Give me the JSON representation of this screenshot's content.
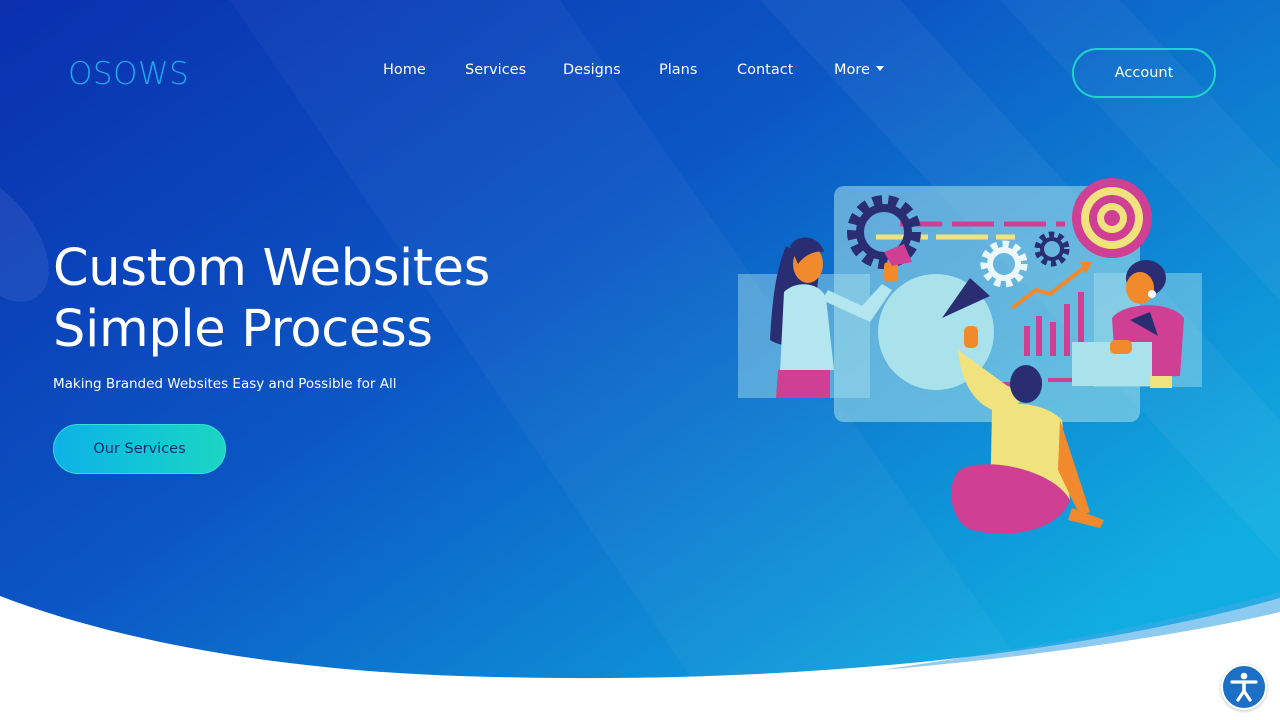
{
  "brand": {
    "logo_text": "OSOWS"
  },
  "nav": {
    "items": [
      {
        "label": "Home"
      },
      {
        "label": "Services"
      },
      {
        "label": "Designs"
      },
      {
        "label": "Plans"
      },
      {
        "label": "Contact"
      },
      {
        "label": "More"
      }
    ],
    "account_label": "Account"
  },
  "hero": {
    "headline_line1": "Custom Websites",
    "headline_line2": "Simple Process",
    "subtitle": "Making Branded Websites Easy and Possible for All",
    "cta_label": "Our Services"
  },
  "colors": {
    "bg_start": "#0a2fae",
    "bg_end": "#10aee0",
    "accent_teal": "#1ed6c8",
    "logo_blue": "#1da9f0"
  },
  "icons": {
    "more_dropdown": "chevron-down-icon",
    "accessibility": "accessibility-icon"
  }
}
